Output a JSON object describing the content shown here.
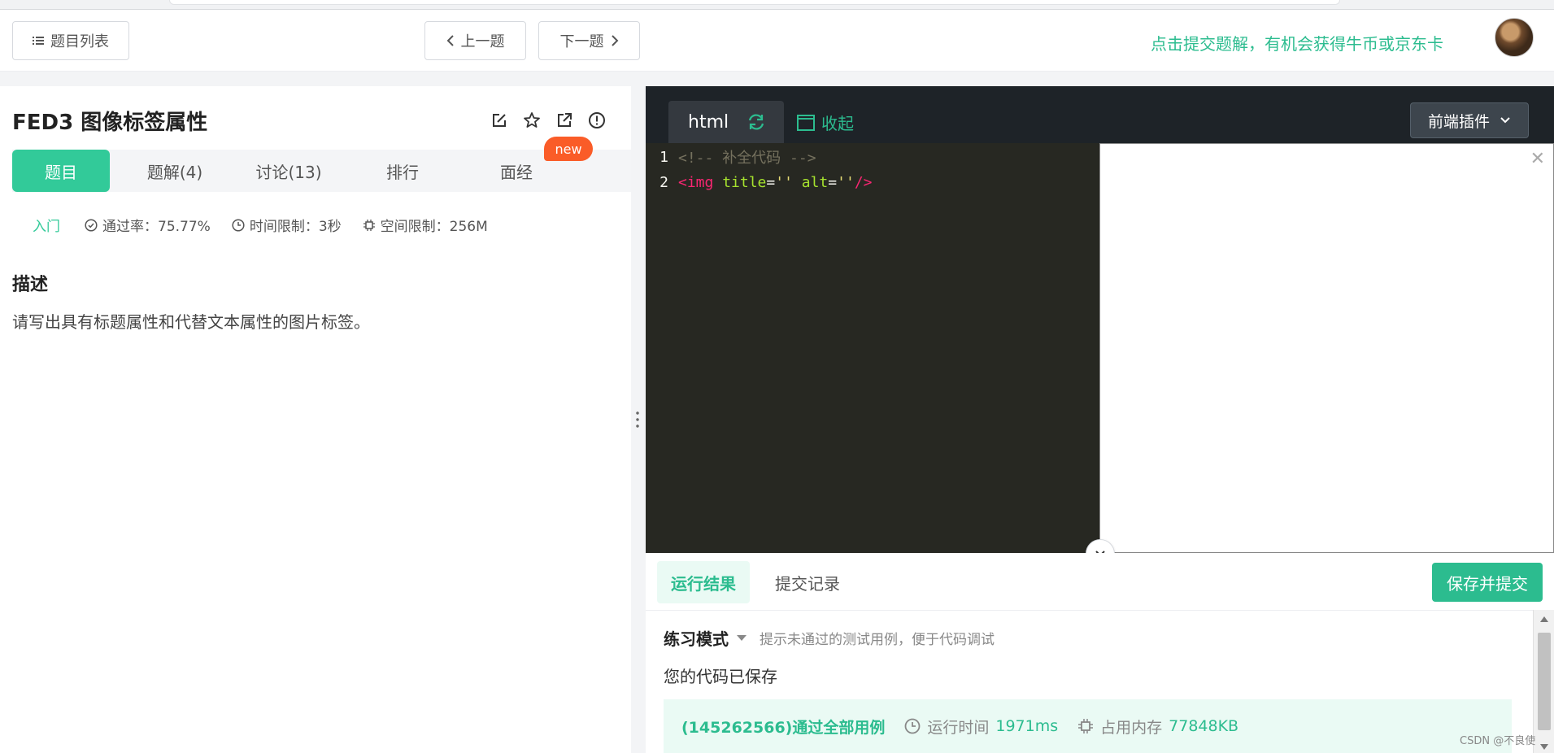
{
  "header": {
    "list_label": "题目列表",
    "prev_label": "上一题",
    "next_label": "下一题",
    "promo_text": "点击提交题解，有机会获得牛币或京东卡"
  },
  "problem": {
    "title": "FED3  图像标签属性",
    "tabs": [
      {
        "label": "题目"
      },
      {
        "label": "题解(4)"
      },
      {
        "label": "讨论(13)"
      },
      {
        "label": "排行"
      },
      {
        "label": "面经"
      }
    ],
    "new_badge": "new",
    "level": "入门",
    "pass_rate": "通过率：75.77%",
    "time_limit": "时间限制：3秒",
    "space_limit": "空间限制：256M",
    "desc_heading": "描述",
    "desc_text": "请写出具有标题属性和代替文本属性的图片标签。"
  },
  "editor": {
    "language": "html",
    "collapse_label": "收起",
    "plugin_label": "前端插件",
    "lines": [
      {
        "num": "1",
        "comment": "<!-- 补全代码 -->"
      },
      {
        "num": "2",
        "tag_open": "<img",
        "attr1": " title",
        "eq1": "=",
        "str1": "''",
        "attr2": " alt",
        "eq2": "=",
        "str2": "''",
        "tag_close": "/>"
      }
    ]
  },
  "result": {
    "tab_run": "运行结果",
    "tab_history": "提交记录",
    "submit_label": "保存并提交",
    "mode_name": "练习模式",
    "mode_hint": "提示未通过的测试用例，便于代码调试",
    "saved_msg": "您的代码已保存",
    "pass_msg": "(145262566)通过全部用例",
    "runtime_label": "运行时间",
    "runtime_value": "1971ms",
    "memory_label": "占用内存",
    "memory_value": "77848KB"
  },
  "watermark": "CSDN @不良使",
  "colors": {
    "accent": "#2cbc8f",
    "tab_active": "#32ca99",
    "badge": "#fa5c28",
    "editor_bg": "#272822"
  }
}
